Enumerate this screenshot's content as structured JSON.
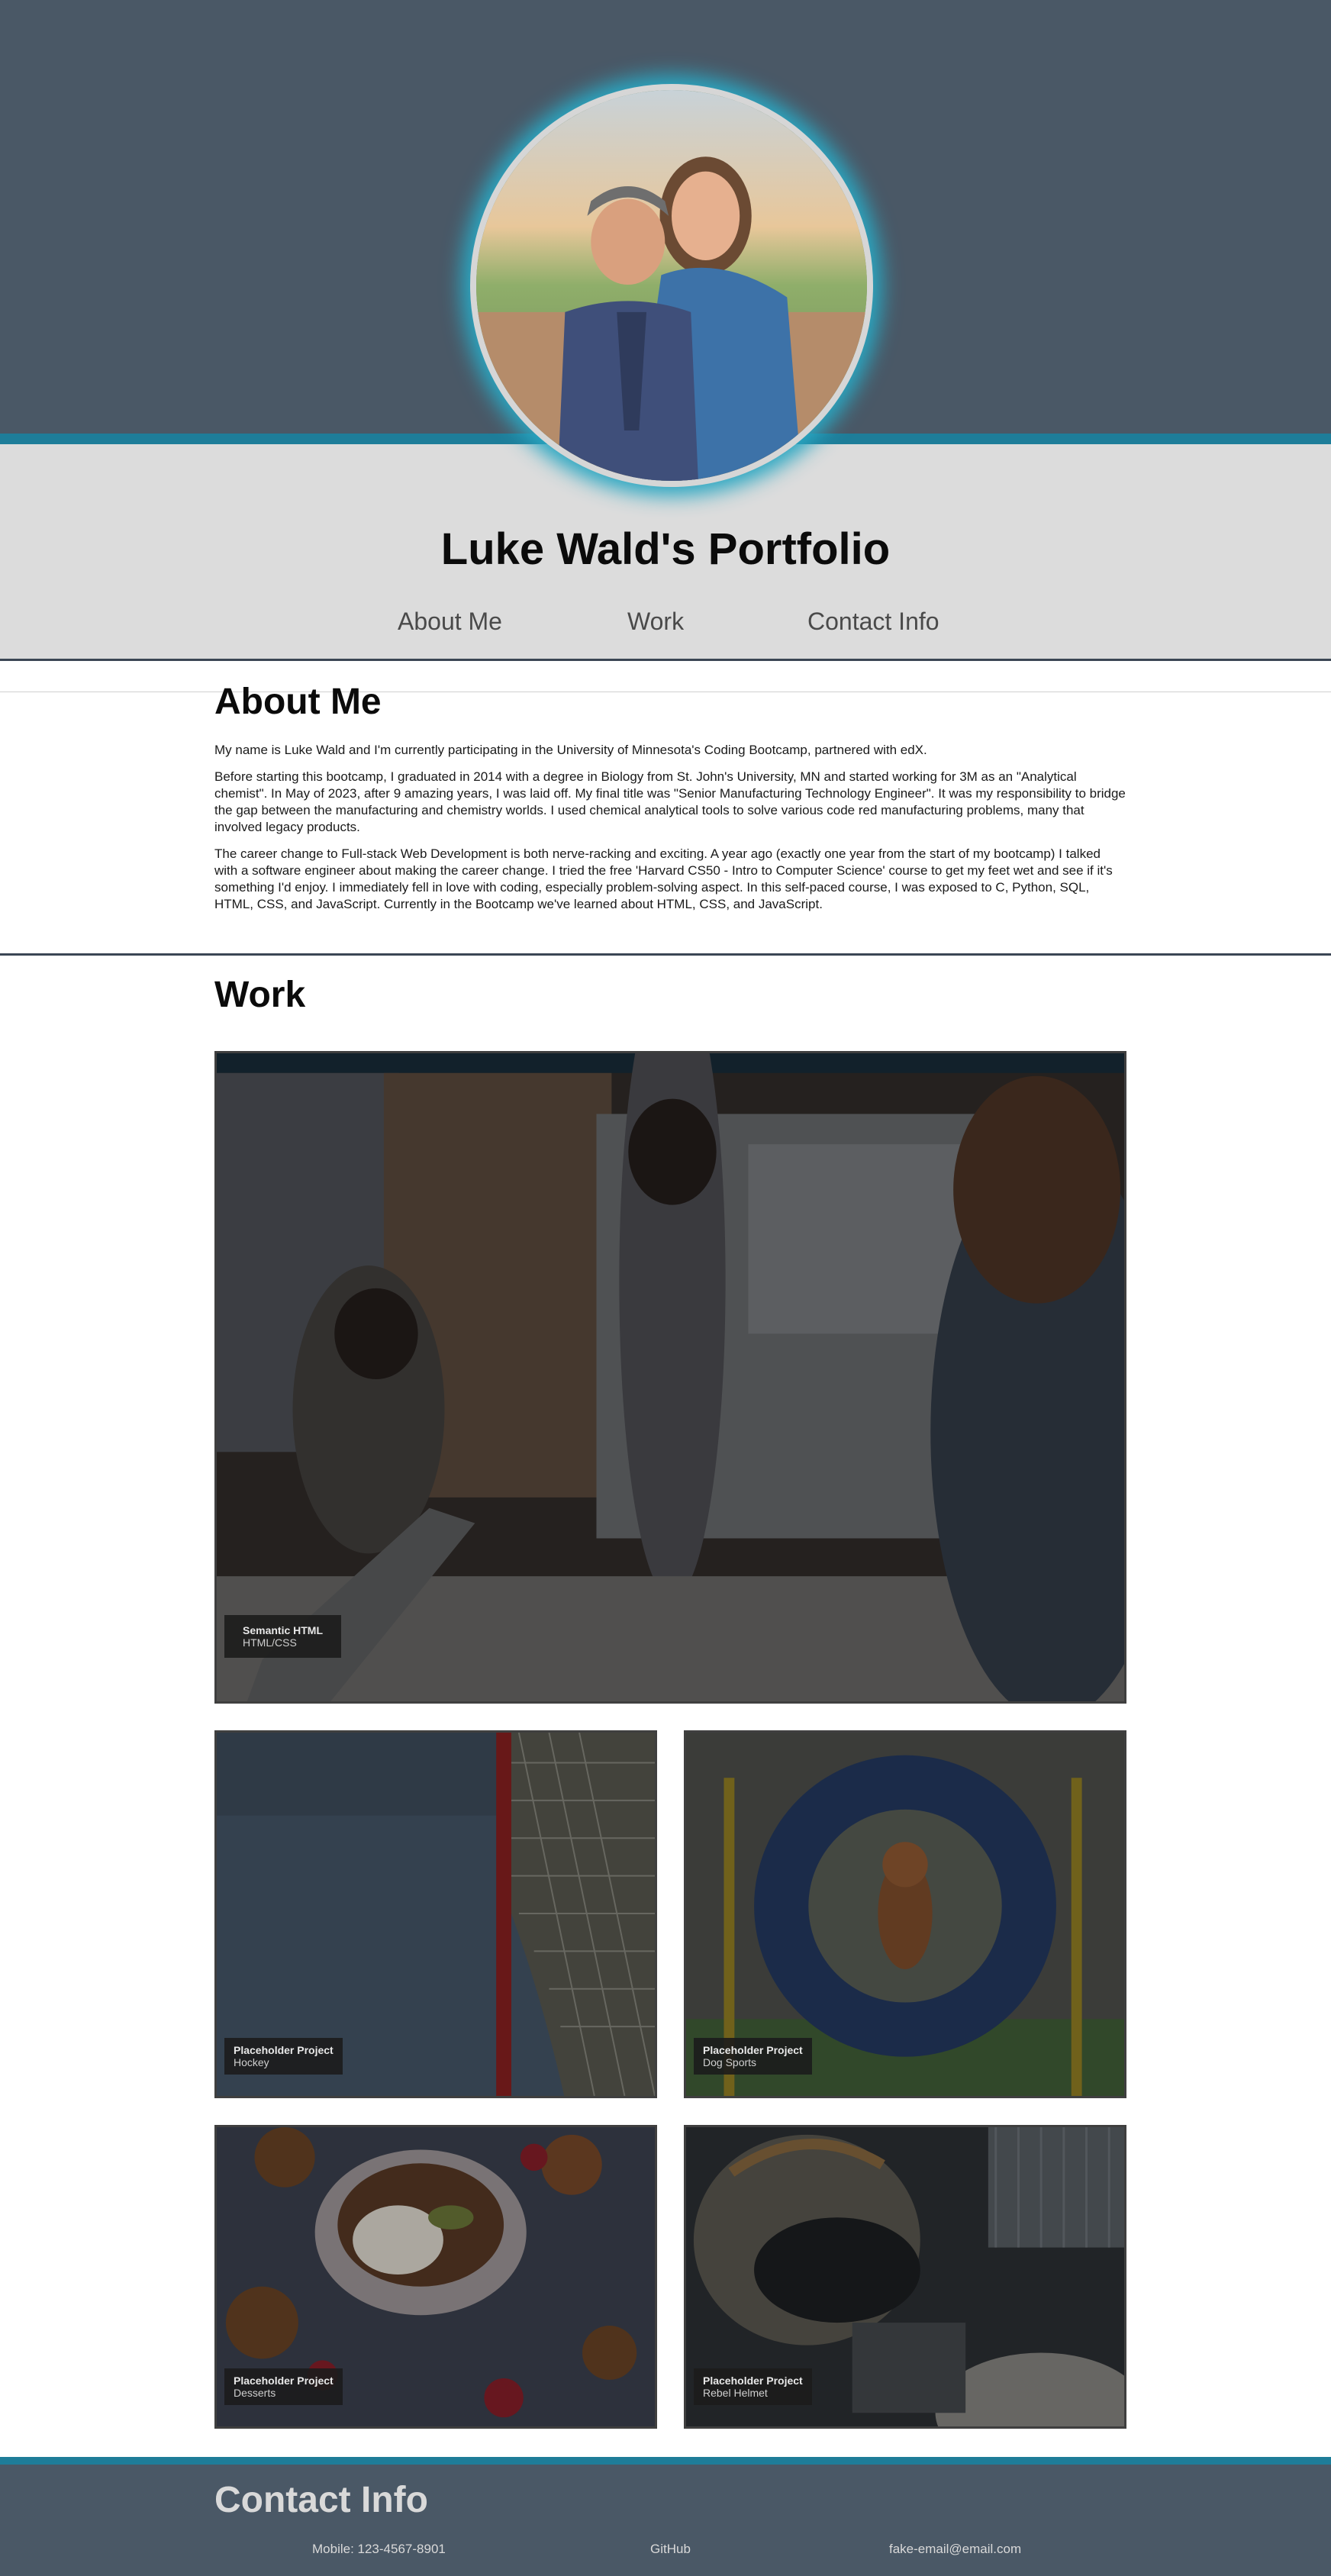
{
  "header": {
    "avatar_alt": "Photo of Luke and partner",
    "site_title": "Luke Wald's Portfolio",
    "nav": [
      {
        "label": "About Me"
      },
      {
        "label": "Work"
      },
      {
        "label": "Contact Info"
      }
    ]
  },
  "about": {
    "heading": "About Me",
    "paragraphs": [
      "My name is Luke Wald and I'm currently participating in the University of Minnesota's Coding Bootcamp, partnered with edX.",
      "Before starting this bootcamp, I graduated in 2014 with a degree in Biology from St. John's University, MN and started working for 3M as an \"Analytical chemist\". In May of 2023, after 9 amazing years, I was laid off. My final title was \"Senior Manufacturing Technology Engineer\". It was my responsibility to bridge the gap between the manufacturing and chemistry worlds. I used chemical analytical tools to solve various code red manufacturing problems, many that involved legacy products.",
      "The career change to Full-stack Web Development is both nerve-racking and exciting. A year ago (exactly one year from the start of my bootcamp) I talked with a software engineer about making the career change. I tried the free 'Harvard CS50 - Intro to Computer Science' course to get my feet wet and see if it's something I'd enjoy. I immediately fell in love with coding, especially problem-solving aspect. In this self-paced course, I was exposed to C, Python, SQL, HTML, CSS, and JavaScript. Currently in the Bootcamp we've learned about HTML, CSS, and JavaScript."
    ]
  },
  "work": {
    "heading": "Work",
    "projects": [
      {
        "title": "Semantic HTML",
        "subtitle": "HTML/CSS"
      },
      {
        "title": "Placeholder Project",
        "subtitle": "Hockey"
      },
      {
        "title": "Placeholder Project",
        "subtitle": "Dog Sports"
      },
      {
        "title": "Placeholder Project",
        "subtitle": "Desserts"
      },
      {
        "title": "Placeholder Project",
        "subtitle": "Rebel Helmet"
      }
    ]
  },
  "contact": {
    "heading": "Contact Info",
    "mobile": "Mobile: 123-4567-8901",
    "github": "GitHub",
    "email": "fake-email@email.com"
  },
  "colors": {
    "header_bg": "#4a5866",
    "accent": "#1e7d99",
    "title_band": "#dcdcdc"
  }
}
